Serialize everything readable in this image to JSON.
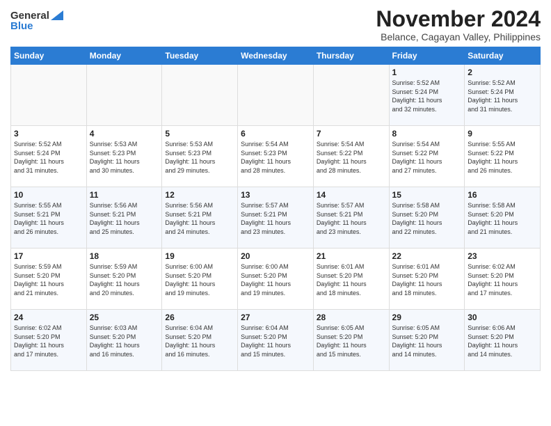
{
  "header": {
    "logo_general": "General",
    "logo_blue": "Blue",
    "month_title": "November 2024",
    "subtitle": "Belance, Cagayan Valley, Philippines"
  },
  "weekdays": [
    "Sunday",
    "Monday",
    "Tuesday",
    "Wednesday",
    "Thursday",
    "Friday",
    "Saturday"
  ],
  "weeks": [
    [
      {
        "day": "",
        "info": ""
      },
      {
        "day": "",
        "info": ""
      },
      {
        "day": "",
        "info": ""
      },
      {
        "day": "",
        "info": ""
      },
      {
        "day": "",
        "info": ""
      },
      {
        "day": "1",
        "info": "Sunrise: 5:52 AM\nSunset: 5:24 PM\nDaylight: 11 hours\nand 32 minutes."
      },
      {
        "day": "2",
        "info": "Sunrise: 5:52 AM\nSunset: 5:24 PM\nDaylight: 11 hours\nand 31 minutes."
      }
    ],
    [
      {
        "day": "3",
        "info": "Sunrise: 5:52 AM\nSunset: 5:24 PM\nDaylight: 11 hours\nand 31 minutes."
      },
      {
        "day": "4",
        "info": "Sunrise: 5:53 AM\nSunset: 5:23 PM\nDaylight: 11 hours\nand 30 minutes."
      },
      {
        "day": "5",
        "info": "Sunrise: 5:53 AM\nSunset: 5:23 PM\nDaylight: 11 hours\nand 29 minutes."
      },
      {
        "day": "6",
        "info": "Sunrise: 5:54 AM\nSunset: 5:23 PM\nDaylight: 11 hours\nand 28 minutes."
      },
      {
        "day": "7",
        "info": "Sunrise: 5:54 AM\nSunset: 5:22 PM\nDaylight: 11 hours\nand 28 minutes."
      },
      {
        "day": "8",
        "info": "Sunrise: 5:54 AM\nSunset: 5:22 PM\nDaylight: 11 hours\nand 27 minutes."
      },
      {
        "day": "9",
        "info": "Sunrise: 5:55 AM\nSunset: 5:22 PM\nDaylight: 11 hours\nand 26 minutes."
      }
    ],
    [
      {
        "day": "10",
        "info": "Sunrise: 5:55 AM\nSunset: 5:21 PM\nDaylight: 11 hours\nand 26 minutes."
      },
      {
        "day": "11",
        "info": "Sunrise: 5:56 AM\nSunset: 5:21 PM\nDaylight: 11 hours\nand 25 minutes."
      },
      {
        "day": "12",
        "info": "Sunrise: 5:56 AM\nSunset: 5:21 PM\nDaylight: 11 hours\nand 24 minutes."
      },
      {
        "day": "13",
        "info": "Sunrise: 5:57 AM\nSunset: 5:21 PM\nDaylight: 11 hours\nand 23 minutes."
      },
      {
        "day": "14",
        "info": "Sunrise: 5:57 AM\nSunset: 5:21 PM\nDaylight: 11 hours\nand 23 minutes."
      },
      {
        "day": "15",
        "info": "Sunrise: 5:58 AM\nSunset: 5:20 PM\nDaylight: 11 hours\nand 22 minutes."
      },
      {
        "day": "16",
        "info": "Sunrise: 5:58 AM\nSunset: 5:20 PM\nDaylight: 11 hours\nand 21 minutes."
      }
    ],
    [
      {
        "day": "17",
        "info": "Sunrise: 5:59 AM\nSunset: 5:20 PM\nDaylight: 11 hours\nand 21 minutes."
      },
      {
        "day": "18",
        "info": "Sunrise: 5:59 AM\nSunset: 5:20 PM\nDaylight: 11 hours\nand 20 minutes."
      },
      {
        "day": "19",
        "info": "Sunrise: 6:00 AM\nSunset: 5:20 PM\nDaylight: 11 hours\nand 19 minutes."
      },
      {
        "day": "20",
        "info": "Sunrise: 6:00 AM\nSunset: 5:20 PM\nDaylight: 11 hours\nand 19 minutes."
      },
      {
        "day": "21",
        "info": "Sunrise: 6:01 AM\nSunset: 5:20 PM\nDaylight: 11 hours\nand 18 minutes."
      },
      {
        "day": "22",
        "info": "Sunrise: 6:01 AM\nSunset: 5:20 PM\nDaylight: 11 hours\nand 18 minutes."
      },
      {
        "day": "23",
        "info": "Sunrise: 6:02 AM\nSunset: 5:20 PM\nDaylight: 11 hours\nand 17 minutes."
      }
    ],
    [
      {
        "day": "24",
        "info": "Sunrise: 6:02 AM\nSunset: 5:20 PM\nDaylight: 11 hours\nand 17 minutes."
      },
      {
        "day": "25",
        "info": "Sunrise: 6:03 AM\nSunset: 5:20 PM\nDaylight: 11 hours\nand 16 minutes."
      },
      {
        "day": "26",
        "info": "Sunrise: 6:04 AM\nSunset: 5:20 PM\nDaylight: 11 hours\nand 16 minutes."
      },
      {
        "day": "27",
        "info": "Sunrise: 6:04 AM\nSunset: 5:20 PM\nDaylight: 11 hours\nand 15 minutes."
      },
      {
        "day": "28",
        "info": "Sunrise: 6:05 AM\nSunset: 5:20 PM\nDaylight: 11 hours\nand 15 minutes."
      },
      {
        "day": "29",
        "info": "Sunrise: 6:05 AM\nSunset: 5:20 PM\nDaylight: 11 hours\nand 14 minutes."
      },
      {
        "day": "30",
        "info": "Sunrise: 6:06 AM\nSunset: 5:20 PM\nDaylight: 11 hours\nand 14 minutes."
      }
    ]
  ]
}
